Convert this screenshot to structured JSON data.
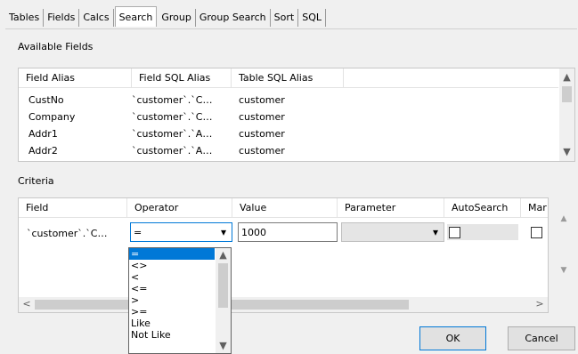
{
  "tabs": [
    "Tables",
    "Fields",
    "Calcs",
    "Search",
    "Group",
    "Group Search",
    "Sort",
    "SQL"
  ],
  "active_tab": "Search",
  "available_fields": {
    "label": "Available Fields",
    "columns": [
      "Field Alias",
      "Field SQL Alias",
      "Table SQL Alias"
    ],
    "rows": [
      [
        "CustNo",
        "`customer`.`C…",
        "customer"
      ],
      [
        "Company",
        "`customer`.`C…",
        "customer"
      ],
      [
        "Addr1",
        "`customer`.`A…",
        "customer"
      ],
      [
        "Addr2",
        "`customer`.`A…",
        "customer"
      ]
    ]
  },
  "criteria": {
    "label": "Criteria",
    "columns": [
      "Field",
      "Operator",
      "Value",
      "Parameter",
      "AutoSearch",
      "Mar"
    ],
    "row": {
      "field": "`customer`.`C…",
      "operator": "=",
      "value": "1000",
      "parameter": "",
      "autosearch": false,
      "mar": false
    },
    "operator_options": [
      "=",
      "<>",
      "<",
      "<=",
      ">",
      ">=",
      "Like",
      "Not Like"
    ],
    "selected_option": "="
  },
  "buttons": {
    "ok": "OK",
    "cancel": "Cancel"
  },
  "icons": {
    "scroll_up": "▲",
    "scroll_down": "▼",
    "scroll_left": "<",
    "scroll_right": ">",
    "dropdown_arrow": "▾",
    "move_up": "▲",
    "move_down": "▼"
  }
}
